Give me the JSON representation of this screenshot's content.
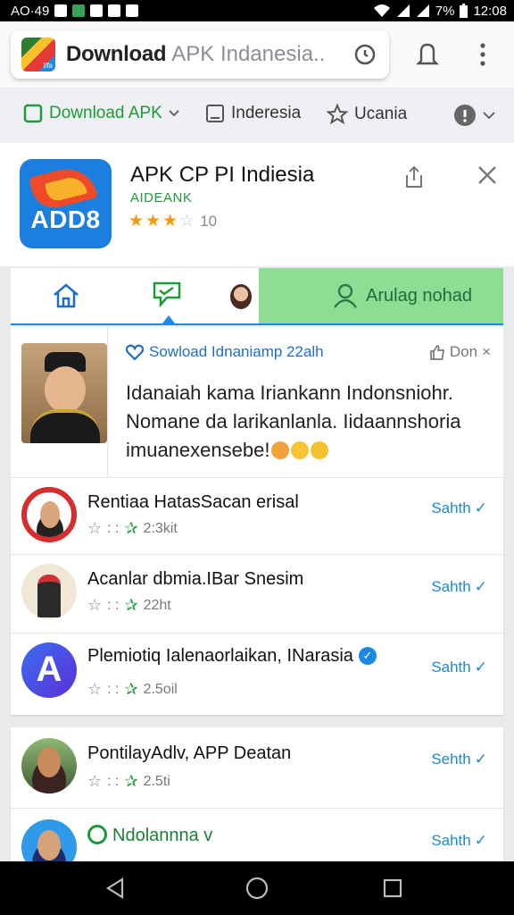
{
  "status_bar": {
    "left_text": "AO·49",
    "battery": "7%",
    "time": "12:08"
  },
  "browser": {
    "url_strong": "Download",
    "url_rest": "APK Indanesia..",
    "favicon_text": "Ilfa"
  },
  "toolbar": {
    "items": [
      {
        "label": "Download APK",
        "icon": "square-outline-icon"
      },
      {
        "label": "Inderesia",
        "icon": "book-icon"
      },
      {
        "label": "Ucania",
        "icon": "star-outline-icon"
      }
    ]
  },
  "app": {
    "title": "APK CP PI Indiesia",
    "developer": "AIDEANK",
    "icon_text": "ADD8",
    "rating_count": "10",
    "colors": {
      "accent_blue": "#1e88e5",
      "green": "#1f9a3a",
      "green_tab": "#8fdc95",
      "star": "#f29a16"
    }
  },
  "tabs": {
    "active_tab_label": "Arulag nohad"
  },
  "post": {
    "heading": "Sowload Idnaniamp 22alh",
    "like_label": "Don",
    "body_lines": [
      "Idanaiah kama Iriankann Indonsniohr.",
      "Nomane da larikanlanla. Iidaannshoria",
      "imuanexensebe!"
    ]
  },
  "list": {
    "rows": [
      {
        "title": "Rentiaa HatasSacan erisal",
        "meta_sep": ": :",
        "count": "2:3kit",
        "action": "Sahth"
      },
      {
        "title": "Acanlar dbmia.IBar Snesim",
        "meta_sep": ": :",
        "count": "22ht",
        "action": "Sahth"
      },
      {
        "title": "Plemiotiq Ialenaorlaikan, INarasia",
        "meta_sep": ": :",
        "count": "2.5oil",
        "action": "Sahth",
        "verified": true
      },
      {
        "title": "PontilayAdlv, APP Deatan",
        "meta_sep": ": :",
        "count": "2.5ti",
        "action": "Sehth"
      },
      {
        "title": "Ndolannna v",
        "meta_sep": "",
        "count": "",
        "action": "Sahth"
      }
    ]
  }
}
